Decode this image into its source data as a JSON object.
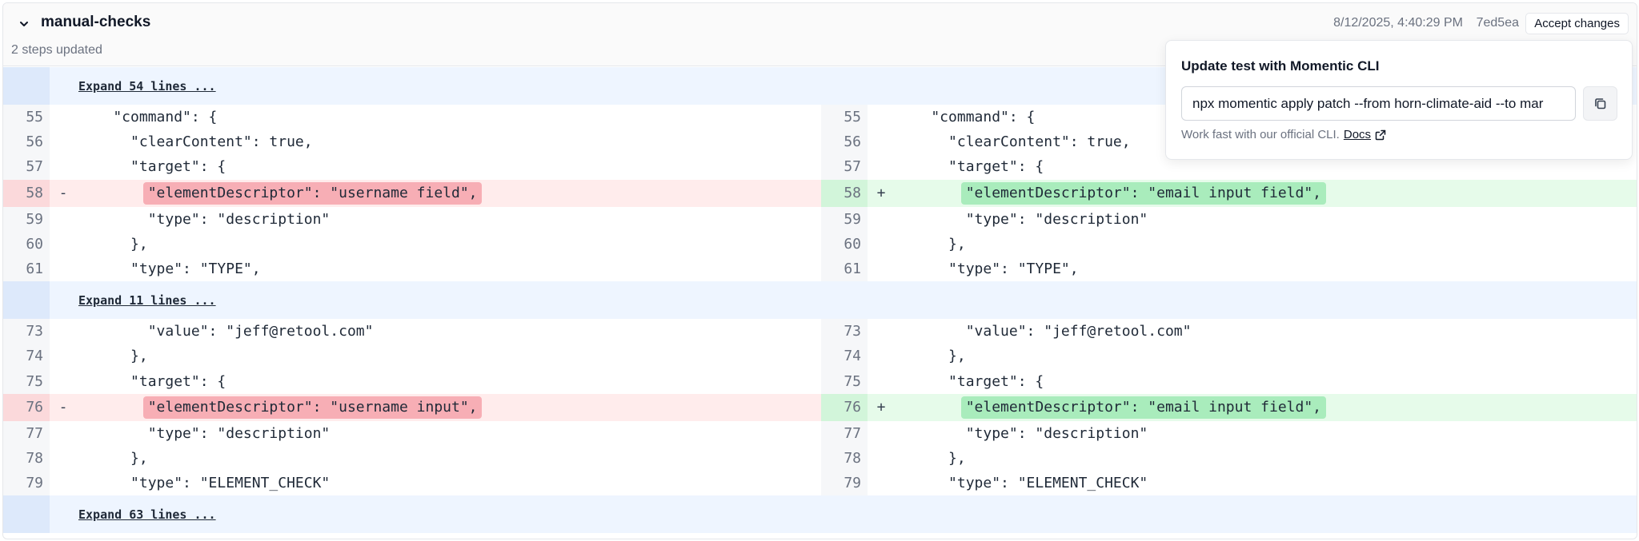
{
  "header": {
    "title": "manual-checks",
    "subtitle": "2 steps updated",
    "timestamp": "8/12/2025, 4:40:29 PM",
    "commit": "7ed5ea",
    "accept_label": "Accept changes"
  },
  "popover": {
    "title": "Update test with Momentic CLI",
    "command": "npx momentic apply patch --from horn-climate-aid --to mar",
    "note": "Work fast with our official CLI.",
    "docs_label": "Docs"
  },
  "diff": {
    "expand": [
      {
        "label": "Expand 54 lines ..."
      },
      {
        "label": "Expand 11 lines ..."
      },
      {
        "label": "Expand 63 lines ..."
      }
    ],
    "hunk1": [
      {
        "ln": "55",
        "left": "    \"command\": {",
        "right": "    \"command\": {"
      },
      {
        "ln": "56",
        "left": "      \"clearContent\": true,",
        "right": "      \"clearContent\": true,"
      },
      {
        "ln": "57",
        "left": "      \"target\": {",
        "right": "      \"target\": {"
      },
      {
        "ln": "58",
        "left": "        \"elementDescriptor\": \"username field\",",
        "right": "        \"elementDescriptor\": \"email input field\",",
        "left_sign": "-",
        "right_sign": "+"
      },
      {
        "ln": "59",
        "left": "        \"type\": \"description\"",
        "right": "        \"type\": \"description\""
      },
      {
        "ln": "60",
        "left": "      },",
        "right": "      },"
      },
      {
        "ln": "61",
        "left": "      \"type\": \"TYPE\",",
        "right": "      \"type\": \"TYPE\","
      }
    ],
    "hunk2": [
      {
        "ln": "73",
        "left": "        \"value\": \"jeff@retool.com\"",
        "right": "        \"value\": \"jeff@retool.com\""
      },
      {
        "ln": "74",
        "left": "      },",
        "right": "      },"
      },
      {
        "ln": "75",
        "left": "      \"target\": {",
        "right": "      \"target\": {"
      },
      {
        "ln": "76",
        "left": "        \"elementDescriptor\": \"username input\",",
        "right": "        \"elementDescriptor\": \"email input field\",",
        "left_sign": "-",
        "right_sign": "+"
      },
      {
        "ln": "77",
        "left": "        \"type\": \"description\"",
        "right": "        \"type\": \"description\""
      },
      {
        "ln": "78",
        "left": "      },",
        "right": "      },"
      },
      {
        "ln": "79",
        "left": "      \"type\": \"ELEMENT_CHECK\"",
        "right": "      \"type\": \"ELEMENT_CHECK\""
      }
    ]
  },
  "colors": {
    "deleted_bg": "#ffecec",
    "deleted_highlight": "#f7aeb5",
    "added_bg": "#e6fbea",
    "added_highlight": "#a9ecbc",
    "expand_bg": "#eef5ff"
  }
}
